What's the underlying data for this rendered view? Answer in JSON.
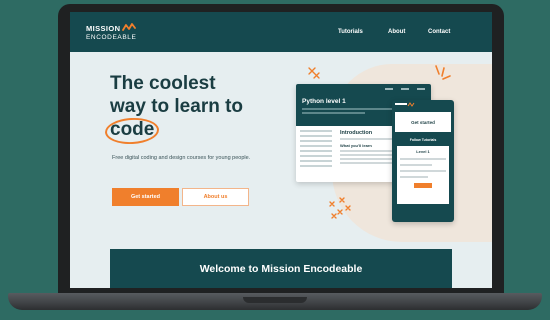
{
  "nav": {
    "logo_top": "MISSION",
    "logo_bottom": "ENCODEABLE",
    "links": [
      "Tutorials",
      "About",
      "Contact"
    ]
  },
  "hero": {
    "title_line1": "The coolest",
    "title_line2": "way to learn to",
    "title_word": "code",
    "subtitle": "Free digital coding and design courses for young people.",
    "primary_button": "Get started",
    "secondary_button": "About us"
  },
  "mockup": {
    "course_title": "Python level 1",
    "intro_heading": "Introduction",
    "what_heading": "What you'll learn",
    "phone_card_title": "Get started",
    "phone_follow": "Follow Tutorials",
    "phone_level": "Level 1"
  },
  "welcome": {
    "title": "Welcome to Mission Encodeable"
  },
  "colors": {
    "brand_dark": "#15494f",
    "accent": "#f07f2c",
    "background": "#e6eef0",
    "backdrop": "#2e6b63"
  }
}
